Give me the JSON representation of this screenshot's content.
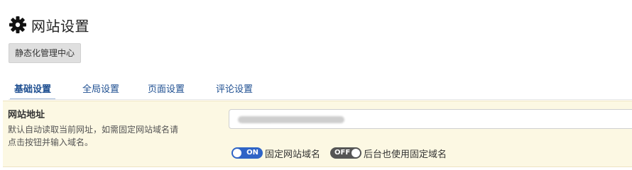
{
  "page": {
    "title": "网站设置",
    "title_icon": "gear-icon"
  },
  "header_button": {
    "label": "静态化管理中心"
  },
  "tabs": [
    {
      "label": "基础设置",
      "active": true
    },
    {
      "label": "全局设置",
      "active": false
    },
    {
      "label": "页面设置",
      "active": false
    },
    {
      "label": "评论设置",
      "active": false
    }
  ],
  "site_url_setting": {
    "title": "网站地址",
    "description_line1": "默认自动读取当前网址，如需固定网站域名请",
    "description_line2": "点击按钮并输入域名。",
    "input_value": "",
    "toggles": [
      {
        "state": "ON",
        "label": "固定网站域名",
        "on": true
      },
      {
        "state": "OFF",
        "label": "后台也使用固定域名",
        "on": false
      }
    ]
  },
  "colors": {
    "accent": "#2f64c6",
    "tab_text": "#1e4f91",
    "row_background": "#fcf8e3"
  }
}
